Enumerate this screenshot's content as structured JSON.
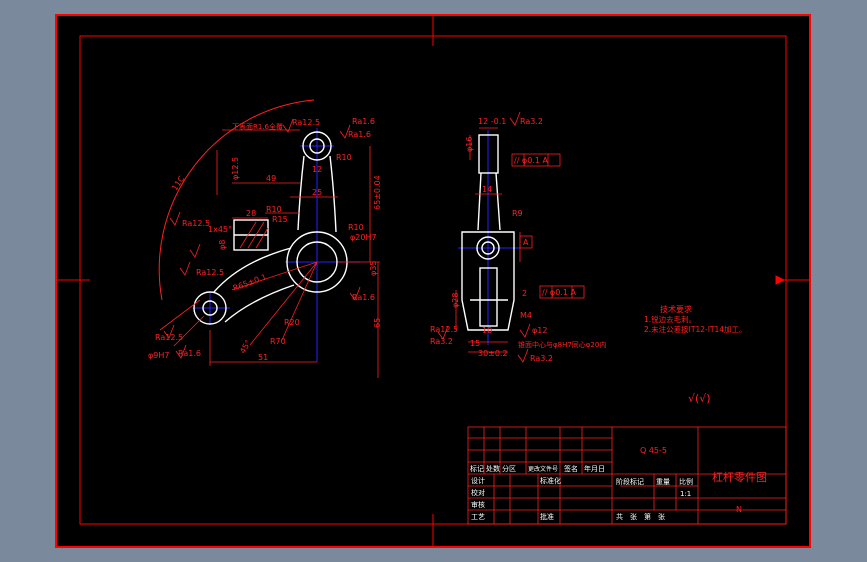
{
  "colors": {
    "frame_bg": "#7a8a9c",
    "paper": "#000000",
    "border": "#ff0000",
    "geometry": "#ffffff",
    "dimension": "#ff2020",
    "centerline": "#2222ff"
  },
  "front_view": {
    "roughness": [
      "Ra12.5",
      "Ra1.6",
      "Ra1.6",
      "Ra12.5",
      "Ra12.5",
      "Ra12.5",
      "Ra1.6",
      "Ra1.6"
    ],
    "dims": {
      "d1": "R10",
      "d2": "12",
      "d3": "49",
      "d4": "R10",
      "d5": "R15",
      "d6": "25",
      "d7": "R10",
      "d8": "φ20H7",
      "d9": "65±0.04",
      "d10": "φ35",
      "d11": "65",
      "d12": "28",
      "d13": "1x45°",
      "d14": "φ8",
      "d15": "R65±0.1",
      "d16": "R20",
      "d17": "R70",
      "d18": "φ9H7",
      "d19": "45°",
      "d20": "51",
      "d21": "11C",
      "d22": "φ12.5"
    },
    "note": "下表面R1.6全覆"
  },
  "side_view": {
    "dims": {
      "t1": "12 -0.1",
      "t2": "φ16",
      "t3": "// φ0.1 A",
      "t4": "14",
      "t5": "R9",
      "t6": "A",
      "t7": "2",
      "t8": "// φ0.1 A",
      "t9": "φ28",
      "t10": "M4",
      "t11": "15",
      "t12": "10",
      "t13": "30±0.2",
      "t14": "φ12",
      "t15": "锥面中心与φ8H7同心φ20内"
    },
    "roughness": [
      "Ra3.2",
      "Ra12.5",
      "Ra3.2",
      "Ra3.2"
    ]
  },
  "tech_req": {
    "title": "技术要求",
    "line1": "1.锐边去毛刺。",
    "line2": "2.未注公差按IT12-IT14加工。"
  },
  "roughness_symbol": "√(√)",
  "title_block": {
    "material": "Q 45-5",
    "name": "杠杆零件图",
    "scale_label": "比例",
    "scale": "1:1",
    "stage_mark": "阶段标记",
    "weight": "重量",
    "sheet_info": "共　张　第　张",
    "row_labels": [
      "标记",
      "处数",
      "分区",
      "更改文件号",
      "签名",
      "年月日"
    ],
    "design": "设计",
    "standard": "标准化",
    "check": "校对",
    "review": "审核",
    "process": "工艺",
    "approve": "批准",
    "code": "N"
  }
}
